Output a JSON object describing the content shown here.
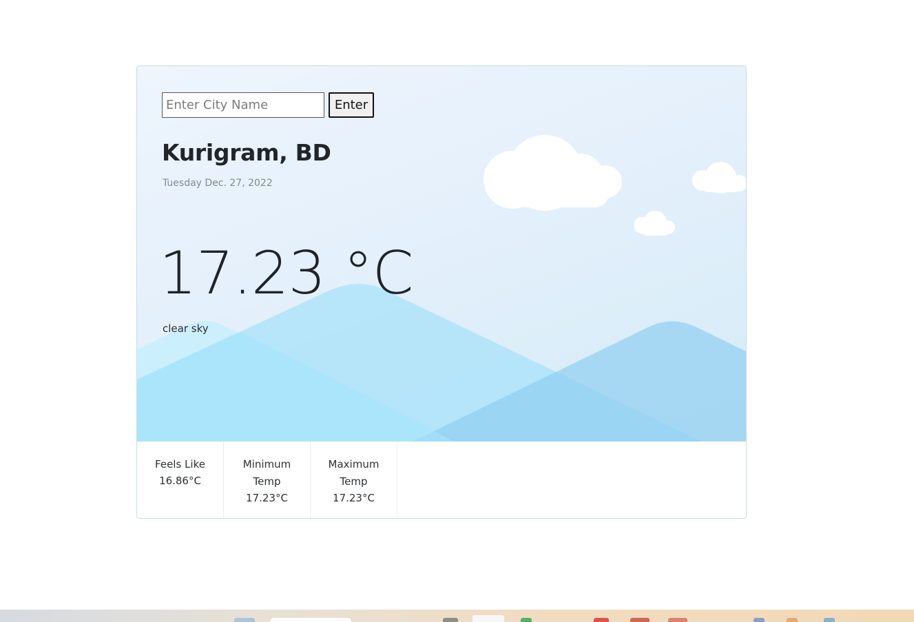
{
  "search": {
    "placeholder": "Enter City Name",
    "value": "",
    "button_label": "Enter"
  },
  "location": {
    "title": "Kurigram, BD"
  },
  "date": "Tuesday Dec. 27, 2022",
  "current": {
    "temperature": "17.23 °C",
    "condition": "clear sky"
  },
  "stats": [
    {
      "label": "Feels Like",
      "value": "16.86°C"
    },
    {
      "label": "Minimum Temp",
      "value": "17.23°C"
    },
    {
      "label": "Maximum Temp",
      "value": "17.23°C"
    }
  ],
  "colors": {
    "sky_top": "#eef5fd",
    "sky_bottom": "#d4ebf7",
    "mountain_light": "#a6e4fb",
    "mountain_dark": "#8ccdf0",
    "cloud": "#ffffff",
    "text": "#212529",
    "muted": "#7d8a93"
  }
}
